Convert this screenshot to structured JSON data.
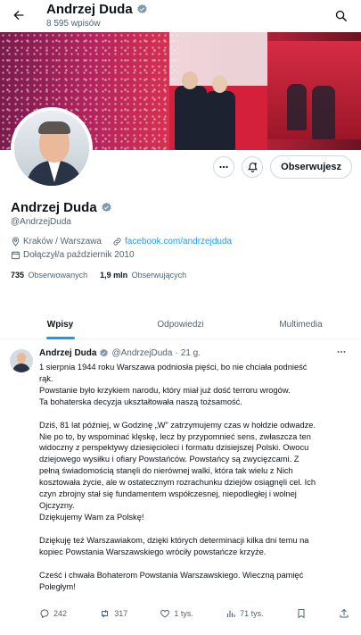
{
  "header": {
    "title": "Andrzej Duda",
    "subtitle": "8 595 wpisów"
  },
  "profile": {
    "name": "Andrzej Duda",
    "handle": "@AndrzejDuda",
    "location": "Kraków / Warszawa",
    "website": "facebook.com/andrzejduda",
    "joined": "Dołączył/a październik 2010",
    "following_count": "735",
    "following_label": "Obserwowanych",
    "followers_count": "1,9 mln",
    "followers_label": "Obserwujących",
    "follow_button": "Obserwujesz",
    "verified_color": "#829aab"
  },
  "tabs": [
    {
      "label": "Wpisy",
      "active": true
    },
    {
      "label": "Odpowiedzi",
      "active": false
    },
    {
      "label": "Multimedia",
      "active": false
    }
  ],
  "tweet": {
    "author": "Andrzej Duda",
    "handle": "@AndrzejDuda",
    "separator": "·",
    "time": "21 g.",
    "lines": [
      "1 sierpnia 1944 roku Warszawa podniosła pięści, bo nie chciała podnieść",
      "rąk.",
      "Powstanie było krzykiem narodu, który miał już dość terroru wrogów.",
      "Ta bohaterska decyzja ukształtowała naszą tożsamość.",
      "",
      "Dziś, 81 lat później, w Godzinę „W” zatrzymujemy czas w hołdzie odwadze.",
      "Nie po to, by wspominać klęskę, lecz by przypomnieć sens, zwłaszcza ten",
      "widoczny z perspektywy dziesięcioleci i formatu dzisiejszej Polski. Owocu",
      "dziejowego wysiłku i ofiary Powstańców. Powstańcy są zwycięzcami. Z",
      "pełną świadomością stanęli do nierównej walki, która tak wielu z Nich",
      "kosztowała życie, ale w ostatecznym rozrachunku dziejów osiągnęli cel. Ich",
      "czyn zbrojny stał się fundamentem współczesnej, niepodległej i wolnej",
      "Ojczyzny.",
      "Dziękujemy Wam za Polskę!",
      "",
      "Dziękuję też Warszawiakom, dzięki których determinacji kilka dni temu na",
      "kopiec Powstania Warszawskiego wróciły powstańcze krzyże.",
      "",
      "Cześć i chwała Bohaterom Powstania Warszawskiego. Wieczną pamięć",
      "Poległym!"
    ],
    "stats": {
      "replies": "242",
      "reposts": "317",
      "likes": "1 tys.",
      "views": "71 tys."
    }
  },
  "icons": {
    "back": "back-arrow-icon",
    "search": "search-icon",
    "more": "more-icon",
    "notify": "notification-bell-icon",
    "location": "location-pin-icon",
    "link": "link-icon",
    "calendar": "calendar-icon",
    "reply": "reply-icon",
    "repost": "repost-icon",
    "like": "heart-icon",
    "views": "views-icon",
    "bookmark": "bookmark-icon",
    "share": "share-icon"
  },
  "colors": {
    "accent": "#1d9bf0",
    "text": "#0f1419",
    "muted": "#536471"
  }
}
